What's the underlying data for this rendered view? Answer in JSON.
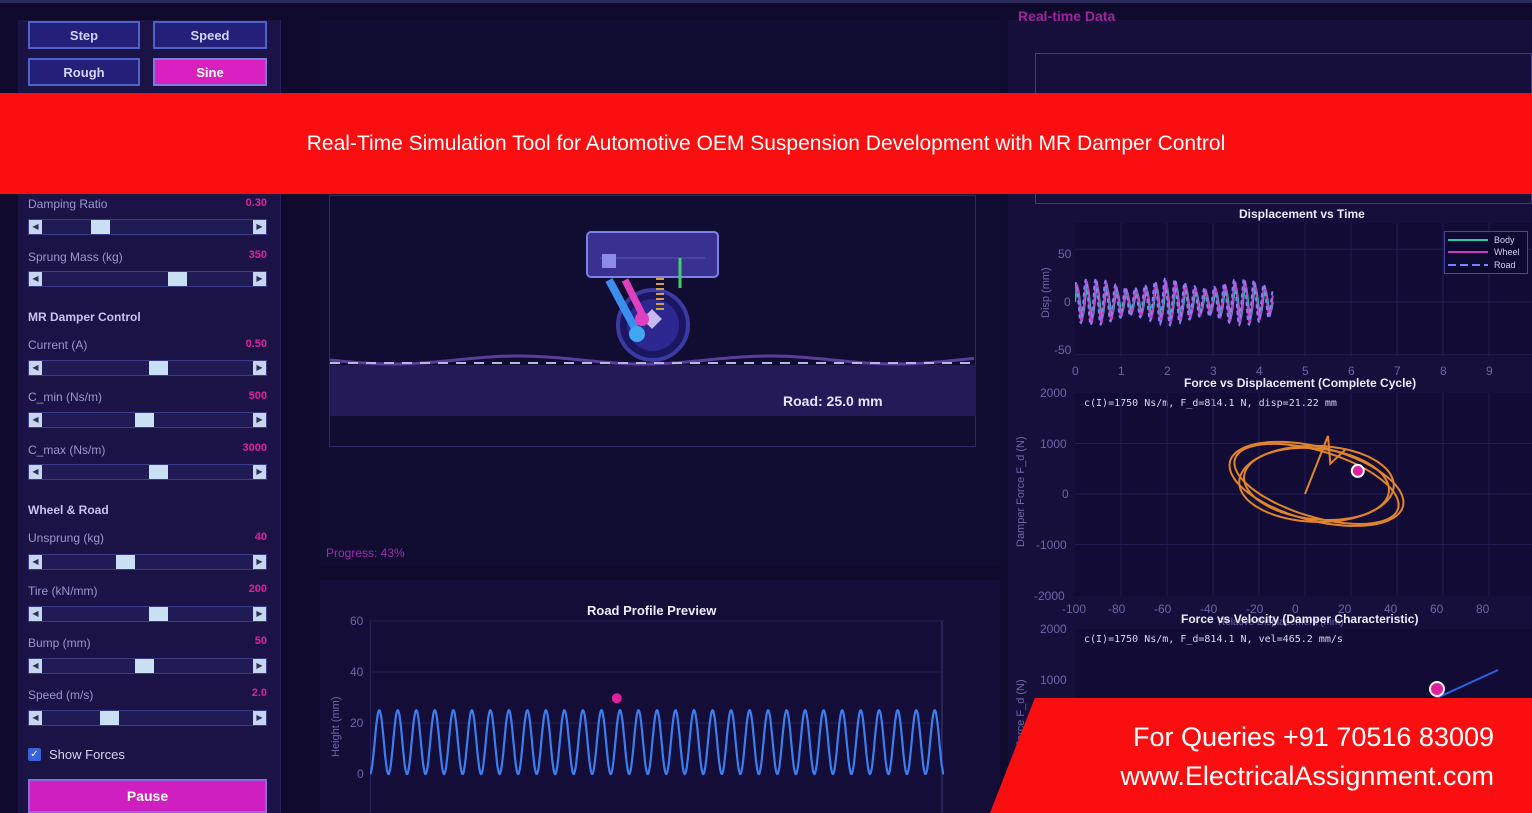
{
  "banner": {
    "title": "Real-Time Simulation Tool for Automotive OEM Suspension Development with MR Damper Control"
  },
  "contact": {
    "phone": "For Queries +91 70516 83009",
    "website": "www.ElectricalAssignment.com"
  },
  "road_modes": [
    {
      "label": "Step",
      "active": false
    },
    {
      "label": "Speed",
      "active": false
    },
    {
      "label": "Rough",
      "active": false
    },
    {
      "label": "Sine",
      "active": true
    }
  ],
  "parameters": {
    "damping_ratio": {
      "label": "Damping Ratio",
      "value": "0.30",
      "level": 0.25
    },
    "sprung_mass": {
      "label": "Sprung Mass (kg)",
      "value": "350",
      "level": 0.65
    }
  },
  "mr_damper": {
    "section": "MR Damper Control",
    "current": {
      "label": "Current (A)",
      "value": "0.50",
      "level": 0.55
    },
    "c_min": {
      "label": "C_min (Ns/m)",
      "value": "500",
      "level": 0.48
    },
    "c_max": {
      "label": "C_max (Ns/m)",
      "value": "3000",
      "level": 0.55
    }
  },
  "wheel_road": {
    "section": "Wheel & Road",
    "unsprung": {
      "label": "Unsprung (kg)",
      "value": "40",
      "level": 0.38
    },
    "tire": {
      "label": "Tire (kN/mm)",
      "value": "200",
      "level": 0.55
    },
    "bump": {
      "label": "Bump (mm)",
      "value": "50",
      "level": 0.48
    },
    "speed": {
      "label": "Speed (m/s)",
      "value": "2.0",
      "level": 0.3
    }
  },
  "controls": {
    "show_forces_label": "Show Forces",
    "show_forces_checked": true,
    "pause_label": "Pause"
  },
  "simulation": {
    "road_label": "Road: 25.0 mm",
    "progress_label": "Progress: 43%",
    "progress": 0.43
  },
  "realtime": {
    "title": "Real-time Data"
  },
  "chart_data": [
    {
      "type": "line",
      "title": "Road Profile Preview",
      "ylabel": "Height (mm)",
      "ylim": [
        0,
        60
      ],
      "yticks": [
        "60",
        "40",
        "20",
        "0"
      ],
      "series": [
        {
          "name": "Road",
          "shape": "sine",
          "amplitude": 12.5,
          "offset": 12.5,
          "cycles": 31,
          "color": "#3a7ef0"
        }
      ],
      "marker": {
        "x_fraction": 0.43,
        "y": 25,
        "color": "#e0209e"
      }
    },
    {
      "type": "line",
      "title": "Displacement vs Time",
      "ylabel": "Disp (mm)",
      "xlim": [
        0,
        10
      ],
      "ylim": [
        -55,
        55
      ],
      "xticks": [
        "0",
        "1",
        "2",
        "3",
        "4",
        "5",
        "6",
        "7",
        "8",
        "9"
      ],
      "yticks": [
        "50",
        "0",
        "-50"
      ],
      "x_end": 4.3,
      "legend_position": "top-right",
      "series": [
        {
          "name": "Body",
          "amplitude": 15,
          "cycles": 20,
          "color": "#22c8a8"
        },
        {
          "name": "Wheel",
          "amplitude": 20,
          "cycles": 20,
          "color": "#c43ab8"
        },
        {
          "name": "Road",
          "amplitude": 22,
          "cycles": 20,
          "color": "#8080ff",
          "dashed": true
        }
      ]
    },
    {
      "type": "scatter",
      "title": "Force vs Displacement (Complete Cycle)",
      "annotation": "c(I)=1750 Ns/m, F_d=814.1 N, disp=21.22 mm",
      "ylabel": "Damper Force F_d (N)",
      "xlabel": "Relative Displacement (mm)",
      "xlim": [
        -100,
        100
      ],
      "ylim": [
        -2000,
        2000
      ],
      "xticks": [
        "-100",
        "-80",
        "-60",
        "-40",
        "-20",
        "0",
        "20",
        "40",
        "60",
        "80"
      ],
      "yticks": [
        "2000",
        "1000",
        "0",
        "-1000",
        "-2000"
      ],
      "loop": {
        "center_x": 5,
        "center_y": 200,
        "radius_x": 35,
        "radius_y": 800,
        "color": "#e0852a"
      },
      "marker": {
        "x": 21.22,
        "y": 814.1,
        "color": "#e0209e"
      }
    },
    {
      "type": "line",
      "title": "Force vs Velocity (Damper Characteristic)",
      "annotation": "c(I)=1750 Ns/m, F_d=814.1 N, vel=465.2 mm/s",
      "ylabel": "Damper Force F_d (N)",
      "yticks": [
        "2000",
        "1000"
      ],
      "ylim": [
        0,
        2000
      ],
      "marker": {
        "color": "#e0209e"
      }
    }
  ]
}
